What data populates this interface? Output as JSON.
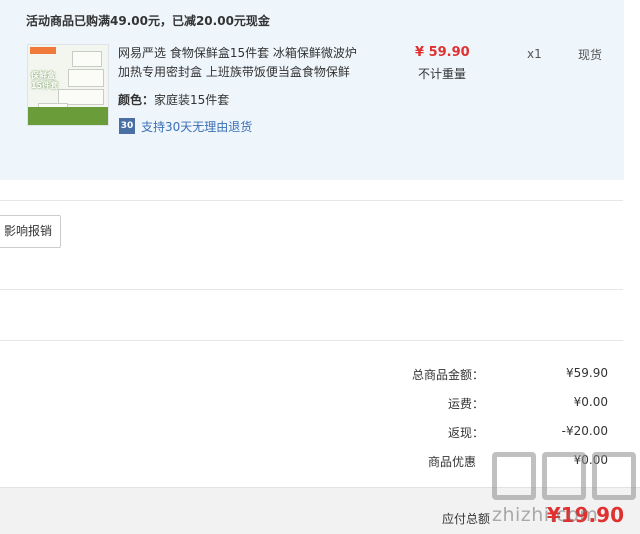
{
  "promo": {
    "title": "活动商品已购满49.00元，已减20.00元现金"
  },
  "item": {
    "thumbnail_label": "保鲜盒\n15件套",
    "name": "网易严选 食物保鲜盒15件套 冰箱保鲜微波炉加热专用密封盒 上班族带饭便当盒食物保鲜",
    "color_label": "颜色：",
    "color_value": "家庭装15件套",
    "return_badge": "30",
    "return_text": "支持30天无理由退货",
    "price": "¥ 59.90",
    "weight_note": "不计重量",
    "quantity": "x1",
    "stock": "现货"
  },
  "reimburse_button": "影响报销",
  "summary": {
    "rows": [
      {
        "label": "总商品金额：",
        "value": "¥59.90"
      },
      {
        "label": "运费：",
        "value": "¥0.00"
      },
      {
        "label": "返现：",
        "value": "-¥20.00"
      },
      {
        "label": "商品优惠",
        "value": "¥0.00"
      }
    ],
    "payable_label": "应付总额",
    "payable_value": "¥19.90"
  },
  "watermark": {
    "text": "zhizhi.com"
  }
}
